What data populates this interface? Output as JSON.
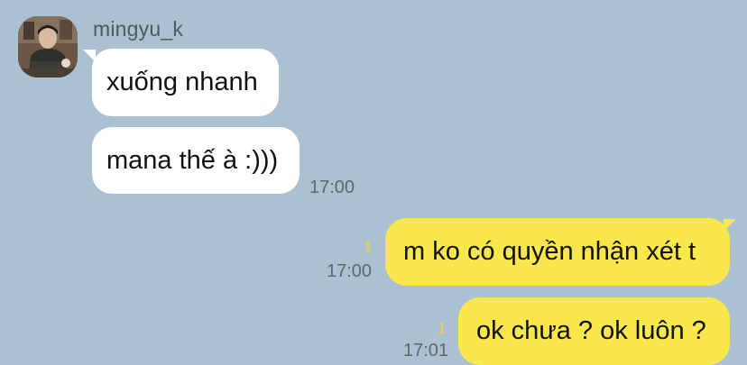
{
  "chat": {
    "sender": {
      "name": "mingyu_k"
    },
    "messages": [
      {
        "direction": "incoming",
        "text": "xuống nhanh"
      },
      {
        "direction": "incoming",
        "text": "mana thế à :)))",
        "time": "17:00"
      },
      {
        "direction": "outgoing",
        "text": "m ko có quyền nhận xét t",
        "time": "17:00",
        "unread": "1"
      },
      {
        "direction": "outgoing",
        "text": "ok chưa ? ok luôn ?",
        "time": "17:01",
        "unread": "1"
      }
    ]
  },
  "colors": {
    "background": "#abc1d1",
    "incoming_bubble": "#ffffff",
    "outgoing_bubble": "#fae74b",
    "unread_counter": "#f6d52a"
  },
  "icons": {
    "avatar": "profile-photo"
  }
}
